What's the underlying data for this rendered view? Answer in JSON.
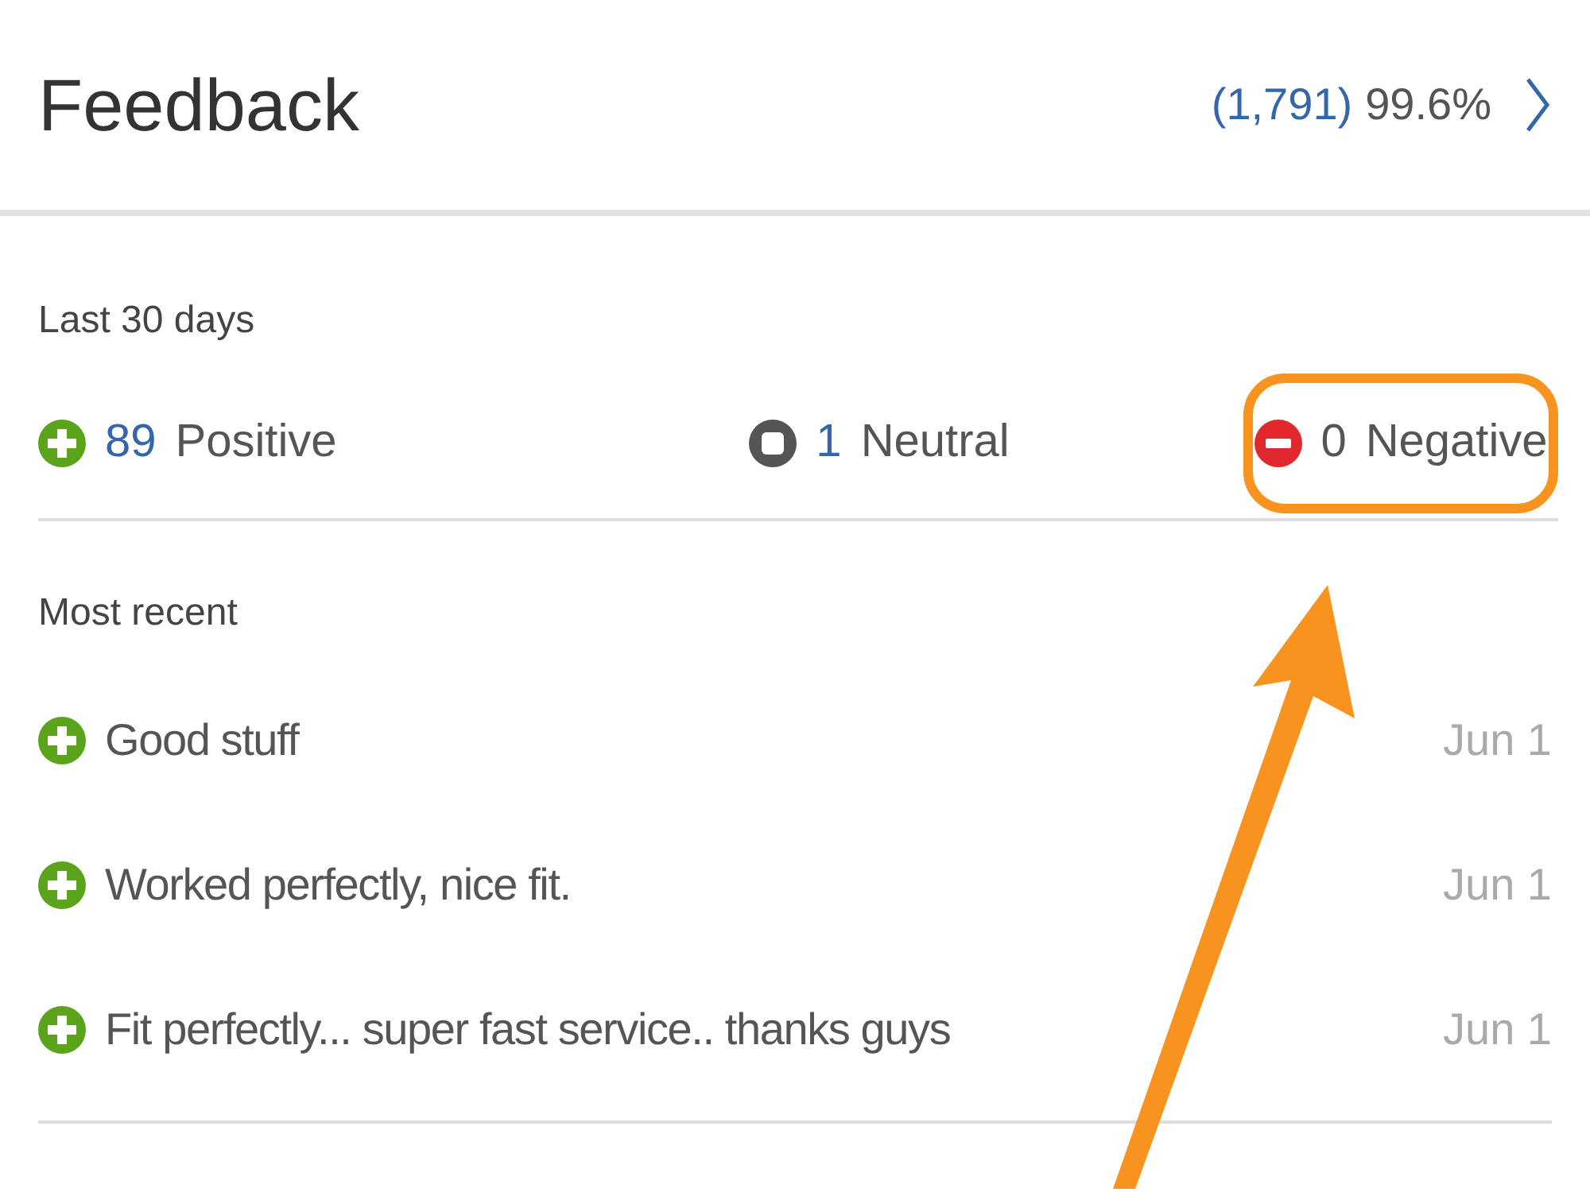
{
  "header": {
    "title": "Feedback",
    "count": "(1,791)",
    "score": "99.6%"
  },
  "summary": {
    "period": "Last 30 days",
    "ratings": [
      {
        "kind": "positive",
        "count": "89",
        "label": "Positive",
        "link": true,
        "highlighted": false
      },
      {
        "kind": "neutral",
        "count": "1",
        "label": "Neutral",
        "link": true,
        "highlighted": false
      },
      {
        "kind": "negative",
        "count": "0",
        "label": "Negative",
        "link": false,
        "highlighted": true
      }
    ]
  },
  "recent": {
    "heading": "Most recent",
    "items": [
      {
        "kind": "positive",
        "comment": "Good stuff",
        "date": "Jun 1"
      },
      {
        "kind": "positive",
        "comment": "Worked perfectly, nice fit.",
        "date": "Jun 1"
      },
      {
        "kind": "positive",
        "comment": "Fit perfectly... super fast service.. thanks guys",
        "date": "Jun 1"
      }
    ]
  }
}
